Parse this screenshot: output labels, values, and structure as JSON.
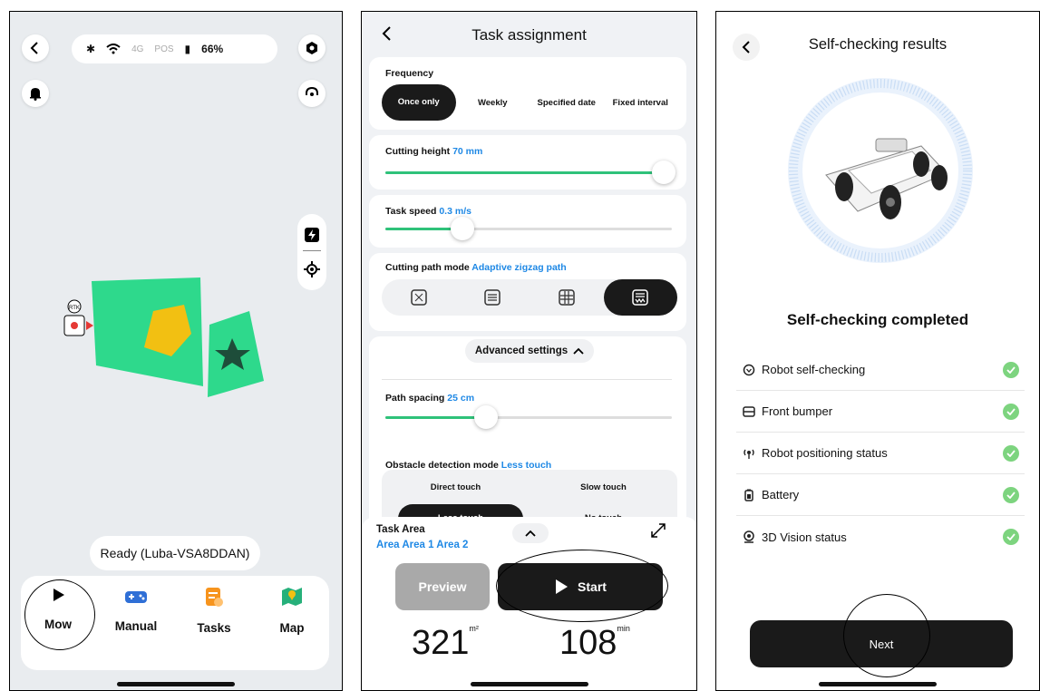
{
  "panel1": {
    "battery": "66%",
    "signal_4g": "4G",
    "pos": "POS",
    "robot_label": "RTK",
    "ready_text": "Ready  (Luba-VSA8DDAN)",
    "tabs": [
      {
        "label": "Mow",
        "icon": "play-icon"
      },
      {
        "label": "Manual",
        "icon": "gamepad-icon"
      },
      {
        "label": "Tasks",
        "icon": "tasks-icon"
      },
      {
        "label": "Map",
        "icon": "map-icon"
      }
    ]
  },
  "panel2": {
    "title": "Task assignment",
    "frequency_label": "Frequency",
    "frequency_options": [
      "Once only",
      "Weekly",
      "Specified date",
      "Fixed interval"
    ],
    "cutting_height_label": "Cutting height",
    "cutting_height_value": "70 mm",
    "cutting_height_level": 0.97,
    "task_speed_label": "Task speed",
    "task_speed_value": "0.3 m/s",
    "task_speed_level": 0.27,
    "path_mode_label": "Cutting path mode",
    "path_mode_value": "Adaptive zigzag path",
    "advanced_label": "Advanced settings",
    "path_spacing_label": "Path spacing",
    "path_spacing_value": "25 cm",
    "path_spacing_level": 0.35,
    "obstacle_label": "Obstacle detection mode",
    "obstacle_value": "Less touch",
    "obstacle_options": [
      "Direct touch",
      "Slow touch",
      "Less touch",
      "No touch"
    ],
    "task_area_label": "Task Area",
    "task_area_value": "Area Area 1 Area 2",
    "preview_label": "Preview",
    "start_label": "Start",
    "area_value": "321",
    "area_unit": "m²",
    "time_value": "108",
    "time_unit": "min"
  },
  "panel3": {
    "title": "Self-checking results",
    "completed": "Self-checking completed",
    "items": [
      "Robot self-checking",
      "Front bumper",
      "Robot positioning status",
      "Battery",
      "3D Vision status"
    ],
    "next_label": "Next"
  },
  "colors": {
    "green": "#2fc27a",
    "lawn": "#2ed98c",
    "accent_blue": "#1e88e5",
    "check": "#7dd47f"
  }
}
